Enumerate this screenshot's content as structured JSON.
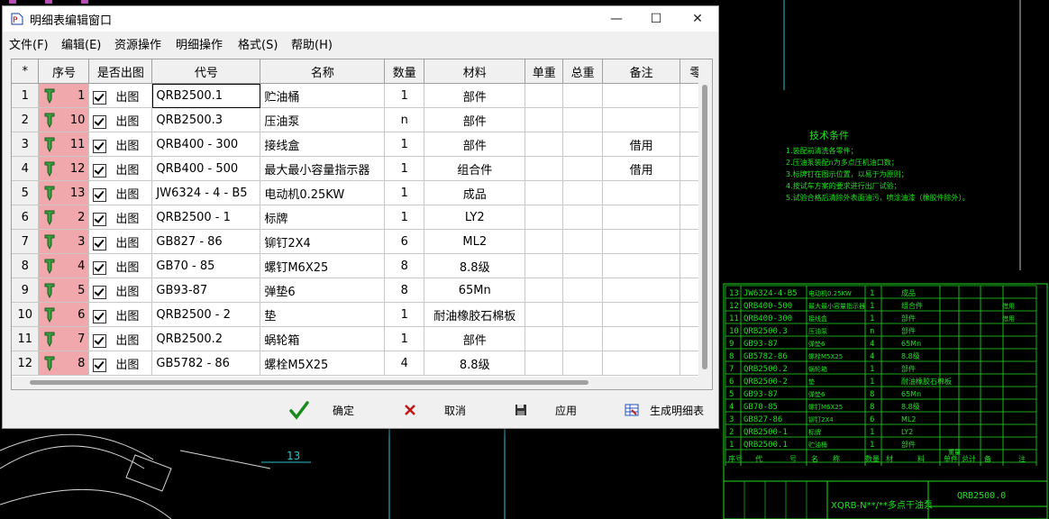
{
  "window": {
    "title": "明细表编辑窗口",
    "minimize_glyph": "—",
    "maximize_glyph": "☐",
    "close_glyph": "✕"
  },
  "menu": [
    "文件(F)",
    "编辑(E)",
    "资源操作",
    "明细操作",
    "格式(S)",
    "帮助(H)"
  ],
  "columns": [
    "*",
    "序号",
    "是否出图",
    "代号",
    "名称",
    "数量",
    "材料",
    "单重",
    "总重",
    "备注",
    "零"
  ],
  "rows": [
    {
      "n": "1",
      "seq": "1",
      "draw": "出图",
      "code": "QRB2500.1",
      "name": "贮油桶",
      "qty": "1",
      "material": "部件",
      "unit_w": "",
      "total_w": "",
      "note": ""
    },
    {
      "n": "2",
      "seq": "10",
      "draw": "出图",
      "code": "QRB2500.3",
      "name": "压油泵",
      "qty": "n",
      "material": "部件",
      "unit_w": "",
      "total_w": "",
      "note": ""
    },
    {
      "n": "3",
      "seq": "11",
      "draw": "出图",
      "code": "QRB400 - 300",
      "name": "接线盒",
      "qty": "1",
      "material": "部件",
      "unit_w": "",
      "total_w": "",
      "note": "借用"
    },
    {
      "n": "4",
      "seq": "12",
      "draw": "出图",
      "code": "QRB400 - 500",
      "name": "最大最小容量指示器",
      "qty": "1",
      "material": "组合件",
      "unit_w": "",
      "total_w": "",
      "note": "借用"
    },
    {
      "n": "5",
      "seq": "13",
      "draw": "出图",
      "code": "JW6324 - 4 - B5",
      "name": "电动机0.25KW",
      "qty": "1",
      "material": "成品",
      "unit_w": "",
      "total_w": "",
      "note": ""
    },
    {
      "n": "6",
      "seq": "2",
      "draw": "出图",
      "code": "QRB2500 - 1",
      "name": "标牌",
      "qty": "1",
      "material": "LY2",
      "unit_w": "",
      "total_w": "",
      "note": ""
    },
    {
      "n": "7",
      "seq": "3",
      "draw": "出图",
      "code": "GB827 - 86",
      "name": "铆钉2X4",
      "qty": "6",
      "material": "ML2",
      "unit_w": "",
      "total_w": "",
      "note": ""
    },
    {
      "n": "8",
      "seq": "4",
      "draw": "出图",
      "code": "GB70 - 85",
      "name": "螺钉M6X25",
      "qty": "8",
      "material": "8.8级",
      "unit_w": "",
      "total_w": "",
      "note": ""
    },
    {
      "n": "9",
      "seq": "5",
      "draw": "出图",
      "code": "GB93-87",
      "name": "弹垫6",
      "qty": "8",
      "material": "65Mn",
      "unit_w": "",
      "total_w": "",
      "note": ""
    },
    {
      "n": "10",
      "seq": "6",
      "draw": "出图",
      "code": "QRB2500 - 2",
      "name": "垫",
      "qty": "1",
      "material": "耐油橡胶石棉板",
      "unit_w": "",
      "total_w": "",
      "note": ""
    },
    {
      "n": "11",
      "seq": "7",
      "draw": "出图",
      "code": "QRB2500.2",
      "name": "蜗轮箱",
      "qty": "1",
      "material": "部件",
      "unit_w": "",
      "total_w": "",
      "note": ""
    },
    {
      "n": "12",
      "seq": "8",
      "draw": "出图",
      "code": "GB5782 - 86",
      "name": "螺栓M5X25",
      "qty": "4",
      "material": "8.8级",
      "unit_w": "",
      "total_w": "",
      "note": ""
    }
  ],
  "buttons": {
    "ok": "确定",
    "cancel": "取消",
    "apply": "应用",
    "generate": "生成明细表"
  },
  "cad": {
    "tech_title": "技术条件",
    "tech_lines": [
      "1.装配前清洗各零件；",
      "2.压油泵装配n为多点压机油口数；",
      "3.标牌钉在图示位置，以易于为原则；",
      "4.按试车方案的要求进行出厂试验；",
      "5.试验合格后清除外表面油污，喷涂油漆（橡胶件除外）。"
    ],
    "bom_rows": [
      {
        "no": "13",
        "code": "JW6324-4-B5",
        "name": "电动机0.25KW",
        "qty": "1",
        "mat": "成品",
        "note": ""
      },
      {
        "no": "12",
        "code": "QRB400-500",
        "name": "最大最小容量指示器",
        "qty": "1",
        "mat": "组合件",
        "note": "借用"
      },
      {
        "no": "11",
        "code": "QRB400-300",
        "name": "接线盒",
        "qty": "1",
        "mat": "部件",
        "note": "借用"
      },
      {
        "no": "10",
        "code": "QRB2500.3",
        "name": "压油泵",
        "qty": "n",
        "mat": "部件",
        "note": ""
      },
      {
        "no": "9",
        "code": "GB93-87",
        "name": "弹垫6",
        "qty": "4",
        "mat": "65Mn",
        "note": ""
      },
      {
        "no": "8",
        "code": "GB5782-86",
        "name": "螺栓M5X25",
        "qty": "4",
        "mat": "8.8级",
        "note": ""
      },
      {
        "no": "7",
        "code": "QRB2500.2",
        "name": "蜗轮箱",
        "qty": "1",
        "mat": "部件",
        "note": ""
      },
      {
        "no": "6",
        "code": "QRB2500-2",
        "name": "垫",
        "qty": "1",
        "mat": "耐油橡胶石棉板",
        "note": ""
      },
      {
        "no": "5",
        "code": "GB93-87",
        "name": "弹垫6",
        "qty": "8",
        "mat": "65Mn",
        "note": ""
      },
      {
        "no": "4",
        "code": "GB70-85",
        "name": "螺钉M6X25",
        "qty": "8",
        "mat": "8.8级",
        "note": ""
      },
      {
        "no": "3",
        "code": "GB827-86",
        "name": "铆钉2X4",
        "qty": "6",
        "mat": "ML2",
        "note": ""
      },
      {
        "no": "2",
        "code": "QRB2500-1",
        "name": "标牌",
        "qty": "1",
        "mat": "LY2",
        "note": ""
      },
      {
        "no": "1",
        "code": "QRB2500.1",
        "name": "贮油桶",
        "qty": "1",
        "mat": "部件",
        "note": ""
      }
    ],
    "bom_header": [
      "序号",
      "代",
      "号",
      "名",
      "称",
      "数量",
      "材",
      "料",
      "单件",
      "总计",
      "备",
      "注"
    ],
    "weight_label": "重量",
    "part_title": "QRB2500.0",
    "product_name": "XQRB-N**/**多点干油泵",
    "callout": "13"
  }
}
